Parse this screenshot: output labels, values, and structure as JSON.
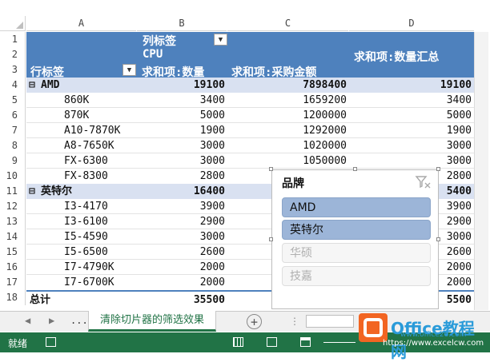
{
  "columns": [
    "A",
    "B",
    "C",
    "D"
  ],
  "rows": [
    "1",
    "2",
    "3",
    "4",
    "5",
    "6",
    "7",
    "8",
    "9",
    "10",
    "11",
    "12",
    "13",
    "14",
    "15",
    "16",
    "17",
    "18"
  ],
  "pivot": {
    "col_label": "列标签",
    "cpu_label": "CPU",
    "row_label": "行标签",
    "header_qty": "求和项:数量",
    "header_amount": "求和项:采购金额",
    "header_qty_total": "求和项:数量汇总",
    "group_amd": {
      "toggle": "⊟",
      "name": "AMD",
      "qty": "19100",
      "amount": "7898400",
      "qty_total": "19100"
    },
    "amd_items": [
      {
        "name": "860K",
        "qty": "3400",
        "amount": "1659200",
        "total": "3400"
      },
      {
        "name": "870K",
        "qty": "5000",
        "amount": "1200000",
        "total": "5000"
      },
      {
        "name": "A10-7870K",
        "qty": "1900",
        "amount": "1292000",
        "total": "1900"
      },
      {
        "name": "A8-7650K",
        "qty": "3000",
        "amount": "1020000",
        "total": "3000"
      },
      {
        "name": "FX-6300",
        "qty": "3000",
        "amount": "1050000",
        "total": "3000"
      },
      {
        "name": "FX-8300",
        "qty": "2800",
        "amount": "",
        "total": "2800"
      }
    ],
    "group_intel": {
      "toggle": "⊟",
      "name": "英特尔",
      "qty": "16400",
      "total": "5400"
    },
    "intel_items": [
      {
        "name": "I3-4170",
        "qty": "3900",
        "total": "3900"
      },
      {
        "name": "I3-6100",
        "qty": "2900",
        "total": "2900"
      },
      {
        "name": "I5-4590",
        "qty": "3000",
        "total": "3000"
      },
      {
        "name": "I5-6500",
        "qty": "2600",
        "total": "2600"
      },
      {
        "name": "I7-4790K",
        "qty": "2000",
        "total": "2000"
      },
      {
        "name": "I7-6700K",
        "qty": "2000",
        "total": "2000"
      }
    ],
    "grand": {
      "label": "总计",
      "qty": "35500",
      "total": "5500"
    }
  },
  "slicer": {
    "title": "品牌",
    "items": [
      {
        "label": "AMD"
      },
      {
        "label": "英特尔"
      },
      {
        "label": "华硕"
      },
      {
        "label": "技嘉"
      }
    ]
  },
  "sheet_tab": "清除切片器的筛选效果",
  "tab_nav": {
    "prev": "◀",
    "next": "▶",
    "more": "...",
    "add": "+"
  },
  "status": {
    "ready": "就绪"
  },
  "watermark": {
    "brand": "Office教程网",
    "url": "www.office26.com",
    "sub": "https://www.excelcw.com"
  },
  "colors": {
    "header_blue": "#4e81bd",
    "band": "#d9e1f1",
    "excel_green": "#217346"
  }
}
